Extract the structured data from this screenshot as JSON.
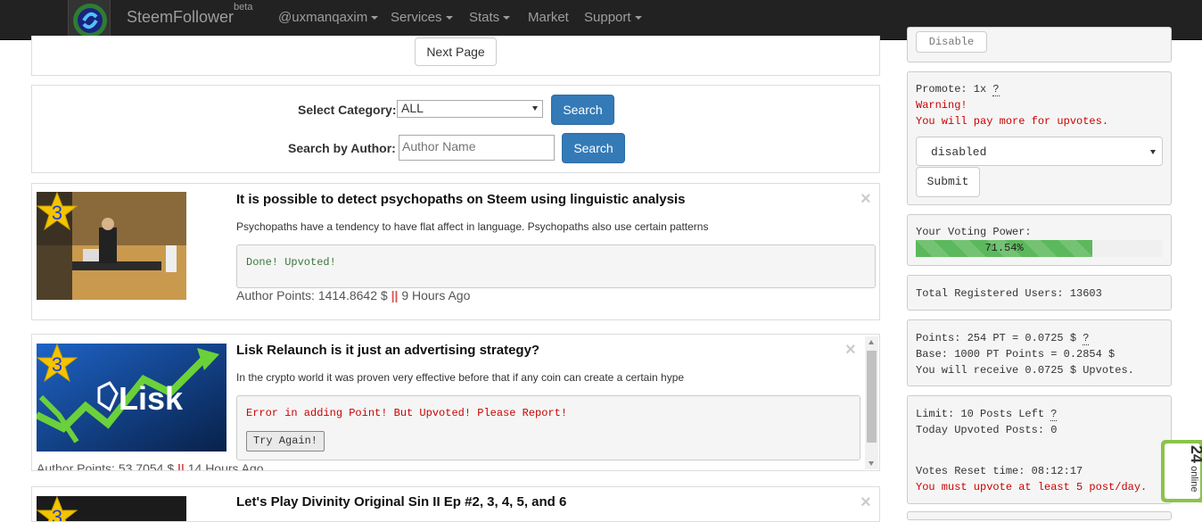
{
  "navbar": {
    "brand": "SteemFollower",
    "brand_sup": "beta",
    "user": "@uxmanqaxim",
    "services": "Services",
    "stats": "Stats",
    "market": "Market",
    "support": "Support"
  },
  "pagination": {
    "next_page": "Next Page"
  },
  "search": {
    "category_label": "Select Category:",
    "category_value": "ALL",
    "search_btn": "Search",
    "author_label": "Search by Author:",
    "author_placeholder": "Author Name",
    "author_search_btn": "Search"
  },
  "posts": [
    {
      "badge": "3",
      "title": "It is possible to detect psychopaths on Steem using linguistic analysis",
      "desc": "Psychopaths have a tendency to have flat affect in language. Psychopaths also use certain patterns",
      "status": "Done! Upvoted!",
      "points": "Author Points: 1414.8642 $",
      "sep": "||",
      "time": "9 Hours Ago",
      "close": "×"
    },
    {
      "badge": "3",
      "title": "Lisk Relaunch is it just an advertising strategy?",
      "desc": "In the crypto world it was proven very effective before that if any coin can create a certain hype",
      "status": "Error in adding Point! But Upvoted! Please Report!",
      "retry": "Try Again!",
      "points": "Author Points: 53.7054 $",
      "sep": "||",
      "time": "14 Hours Ago",
      "close": "×",
      "thumb_text": "Lisk"
    },
    {
      "badge": "3",
      "title": "Let's Play Divinity Original Sin II Ep #2, 3, 4, 5, and 6",
      "close": "×"
    }
  ],
  "sidebar": {
    "disable_btn": "Disable",
    "promote_label": "Promote: 1x",
    "help": "?",
    "warning": "Warning!",
    "warning_text": "You will pay more for upvotes.",
    "promote_select": "disabled",
    "submit": "Submit",
    "voting_power_label": "Your Voting Power:",
    "voting_power_value": "71.54%",
    "voting_power_fraction": 0.7154,
    "total_users": "Total Registered Users: 13603",
    "points": "Points: 254 PT = 0.0725 $",
    "base": "Base: 1000 PT Points = 0.2854 $",
    "receive": "You will receive 0.0725 $ Upvotes.",
    "limit": "Limit: 10 Posts Left",
    "today": "Today Upvoted Posts: 0",
    "reset": "Votes Reset time: 08:12:17",
    "must": "You must upvote at least 5 post/day."
  },
  "online_widget": {
    "count": "24",
    "label": "online",
    "sub": "online"
  },
  "colors": {
    "navbar": "#222222",
    "primary": "#337ab7",
    "success": "#5cb85c",
    "error": "#cc0000",
    "done": "#3c763d"
  }
}
